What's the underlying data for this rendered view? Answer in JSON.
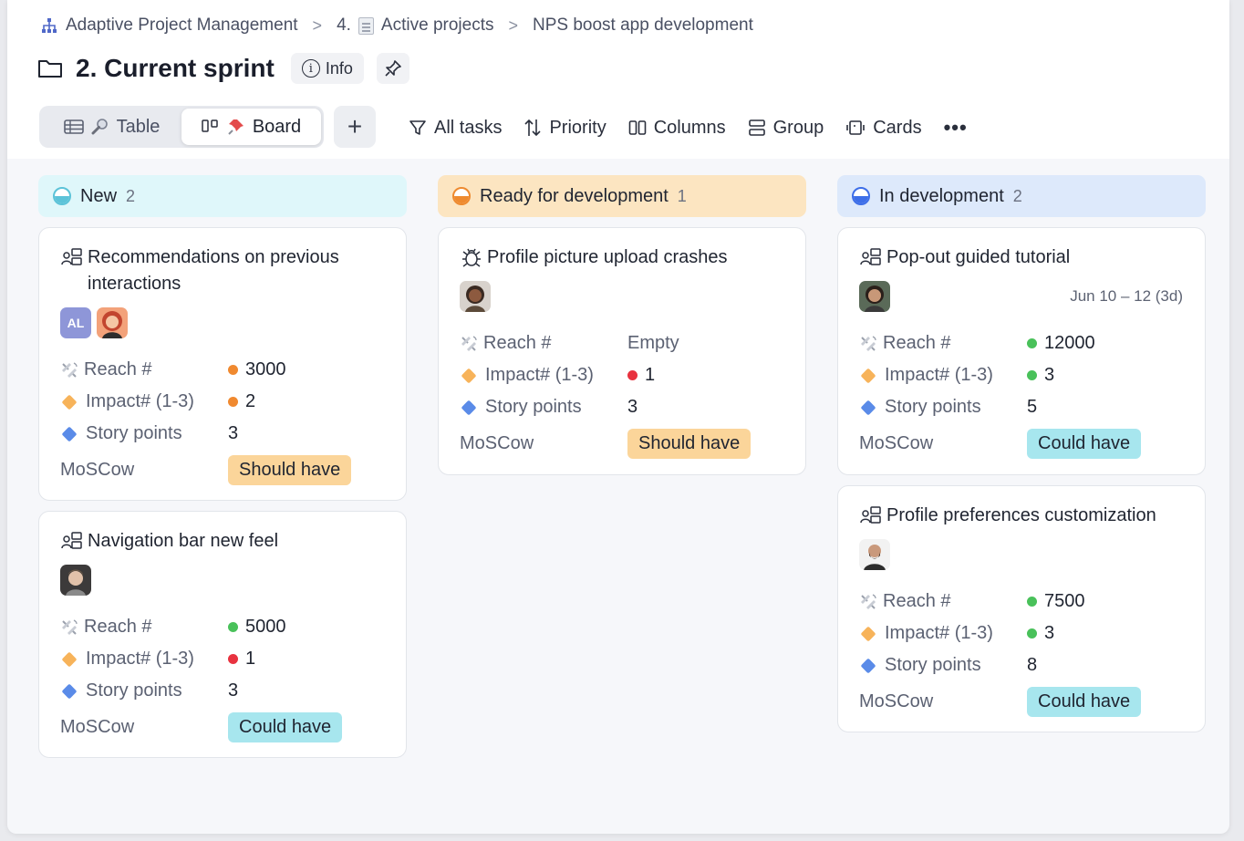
{
  "breadcrumb": {
    "items": [
      {
        "label": "Adaptive Project Management"
      },
      {
        "label": "4."
      },
      {
        "label": "Active projects"
      },
      {
        "label": "NPS boost app development"
      }
    ],
    "separator": ">"
  },
  "header": {
    "title": "2.  Current sprint",
    "info_label": "Info"
  },
  "views": {
    "table_label": "Table",
    "board_label": "Board",
    "active": "Board",
    "add_label": "+"
  },
  "toolbar": {
    "filter_label": "All tasks",
    "sort_label": "Priority",
    "columns_label": "Columns",
    "group_label": "Group",
    "cards_label": "Cards",
    "more_label": "•••"
  },
  "field_labels": {
    "reach": "Reach #",
    "impact": "Impact# (1-3)",
    "story": "Story points",
    "moscow": "MoSCow"
  },
  "colors": {
    "dot_orange": "#f0892f",
    "dot_green": "#49c15a",
    "dot_red": "#e8323f",
    "pill_should": "#fbd59a",
    "pill_could": "#a7e6ee",
    "status_new": "#5cc3d8",
    "status_ready": "#ee8a2f",
    "status_dev": "#3d6ee8"
  },
  "columns": [
    {
      "title": "New",
      "count": "2",
      "cards": [
        {
          "title": "Recommendations on previous interactions",
          "avatars": [
            "AL",
            "photo"
          ],
          "reach": "3000",
          "reach_dot": "orange",
          "impact": "2",
          "impact_dot": "orange",
          "story": "3",
          "moscow": "Should have"
        },
        {
          "title": "Navigation bar new feel",
          "avatars": [
            "photo"
          ],
          "reach": "5000",
          "reach_dot": "green",
          "impact": "1",
          "impact_dot": "red",
          "story": "3",
          "moscow": "Could have"
        }
      ]
    },
    {
      "title": "Ready for development",
      "count": "1",
      "cards": [
        {
          "title": "Profile picture upload crashes",
          "avatars": [
            "photo"
          ],
          "reach": "Empty",
          "impact": "1",
          "impact_dot": "red",
          "story": "3",
          "moscow": "Should have"
        }
      ]
    },
    {
      "title": "In development",
      "count": "2",
      "cards": [
        {
          "title": "Pop-out guided tutorial",
          "avatars": [
            "photo"
          ],
          "date": "Jun 10 – 12 (3d)",
          "reach": "12000",
          "reach_dot": "green",
          "impact": "3",
          "impact_dot": "green",
          "story": "5",
          "moscow": "Could have"
        },
        {
          "title": "Profile preferences customization",
          "avatars": [
            "photo"
          ],
          "reach": "7500",
          "reach_dot": "green",
          "impact": "3",
          "impact_dot": "green",
          "story": "8",
          "moscow": "Could have"
        }
      ]
    }
  ]
}
